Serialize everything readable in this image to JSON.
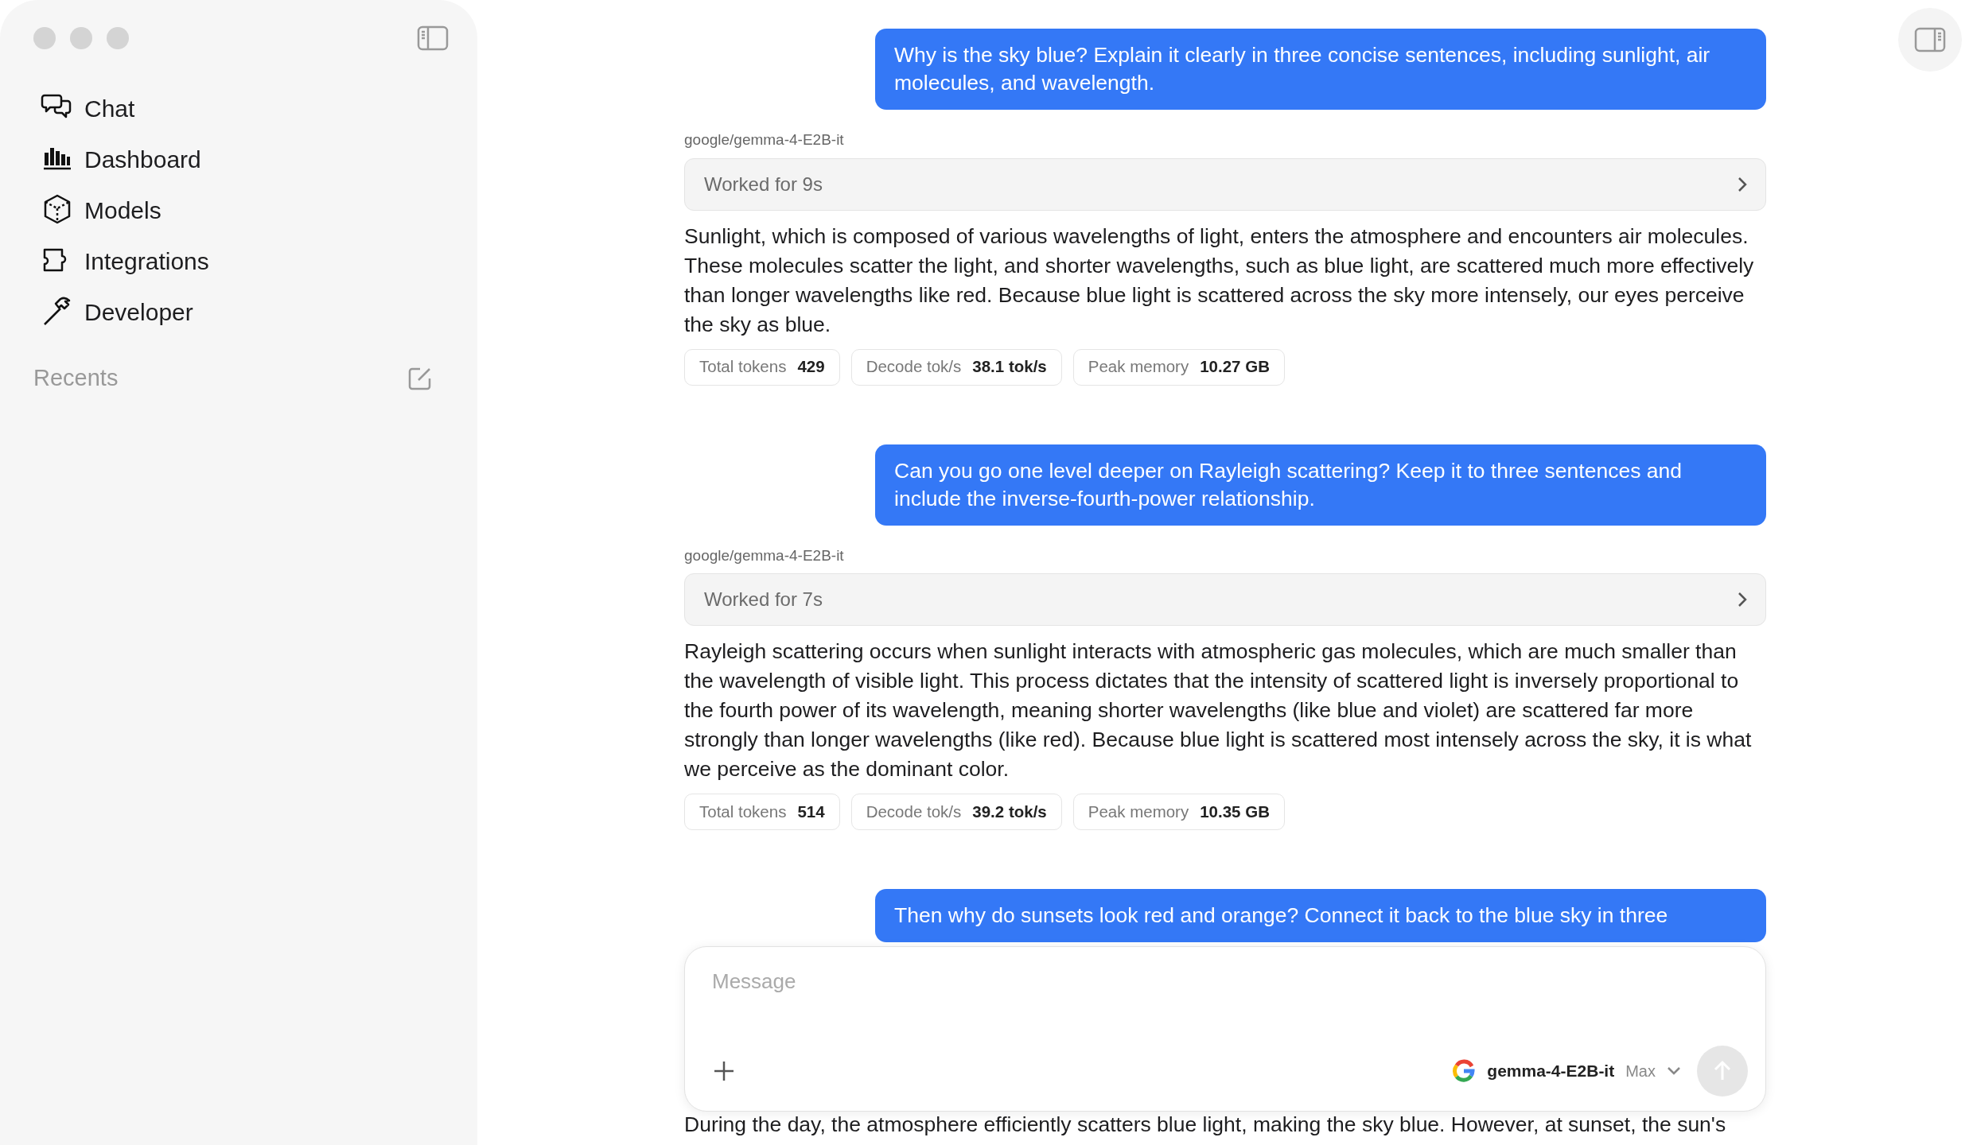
{
  "sidebar": {
    "nav": [
      {
        "label": "Chat",
        "kind": "chat"
      },
      {
        "label": "Dashboard",
        "kind": "dashboard"
      },
      {
        "label": "Models",
        "kind": "models"
      },
      {
        "label": "Integrations",
        "kind": "integrations"
      },
      {
        "label": "Developer",
        "kind": "developer"
      }
    ],
    "recents_label": "Recents"
  },
  "messages": [
    {
      "kind": "user",
      "text": "Why is the sky blue? Explain it clearly in three concise sentences, including sunlight, air molecules, and wavelength."
    },
    {
      "kind": "assistant",
      "model": "google/gemma-4-E2B-it",
      "worked": "Worked for 9s",
      "text": "Sunlight, which is composed of various wavelengths of light, enters the atmosphere and encounters air molecules. These molecules scatter the light, and shorter wavelengths, such as blue light, are scattered much more effectively than longer wavelengths like red. Because blue light is scattered across the sky more intensely, our eyes perceive the sky as blue.",
      "stats": [
        {
          "label": "Total tokens",
          "value": "429"
        },
        {
          "label": "Decode tok/s",
          "value": "38.1 tok/s"
        },
        {
          "label": "Peak memory",
          "value": "10.27 GB"
        }
      ]
    },
    {
      "kind": "user",
      "text": "Can you go one level deeper on Rayleigh scattering? Keep it to three sentences and include the inverse-fourth-power relationship."
    },
    {
      "kind": "assistant",
      "model": "google/gemma-4-E2B-it",
      "worked": "Worked for 7s",
      "text": "Rayleigh scattering occurs when sunlight interacts with atmospheric gas molecules, which are much smaller than the wavelength of visible light. This process dictates that the intensity of scattered light is inversely proportional to the fourth power of its wavelength, meaning shorter wavelengths (like blue and violet) are scattered far more strongly than longer wavelengths (like red). Because blue light is scattered most intensely across the sky, it is what we perceive as the dominant color.",
      "stats": [
        {
          "label": "Total tokens",
          "value": "514"
        },
        {
          "label": "Decode tok/s",
          "value": "39.2 tok/s"
        },
        {
          "label": "Peak memory",
          "value": "10.35 GB"
        }
      ]
    },
    {
      "kind": "user",
      "text": "Then why do sunsets look red and orange? Connect it back to the blue sky in three"
    },
    {
      "kind": "tail",
      "text": "During the day, the atmosphere efficiently scatters blue light, making the sky blue. However, at sunset, the sun's"
    }
  ],
  "composer": {
    "placeholder": "Message",
    "model": "gemma-4-E2B-it",
    "effort": "Max",
    "send_enabled": false
  }
}
